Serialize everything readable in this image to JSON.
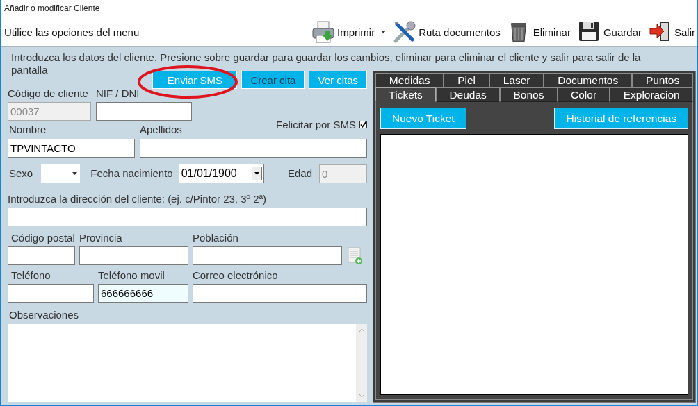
{
  "window": {
    "title": "Añadir o modificar Cliente"
  },
  "toolbar": {
    "hint": "Utilice las opciones del menu",
    "buttons": [
      {
        "label": "Imprimir",
        "kind": "print",
        "dropdown": true
      },
      {
        "label": "Ruta documentos",
        "kind": "tools",
        "dropdown": false
      },
      {
        "label": "Eliminar",
        "kind": "delete",
        "dropdown": false
      },
      {
        "label": "Guardar",
        "kind": "save",
        "dropdown": false
      },
      {
        "label": "Salir",
        "kind": "exit",
        "dropdown": false
      }
    ]
  },
  "form": {
    "instructions": "Introduzca los datos del cliente, Presione sobre guardar para guardar los cambios, eliminar para eliminar el cliente y salir para salir de la pantalla",
    "actions": [
      {
        "label": "Enviar SMS",
        "highlighted": true,
        "hovered": false
      },
      {
        "label": "Crear cita",
        "highlighted": false,
        "hovered": true
      },
      {
        "label": "Ver citas",
        "highlighted": false,
        "hovered": false
      }
    ],
    "customer_code": {
      "label": "Código de cliente",
      "value": "00037",
      "disabled": true
    },
    "nif": {
      "label": "NIF / DNI",
      "disabled": false
    },
    "birthday_sms": {
      "label": "Felicitar por SMS",
      "checked": true
    },
    "first_name": {
      "label": "Nombre",
      "value": "TPVINTACTO"
    },
    "last_name": {
      "label": "Apellidos"
    },
    "sex": {
      "label": "Sexo"
    },
    "birth_date": {
      "label": "Fecha nacimiento",
      "value": "01/01/1900"
    },
    "age": {
      "label": "Edad",
      "value": "0",
      "disabled": true
    },
    "address": {
      "label": "Introduzca la dirección del cliente: (ej. c/Pintor 23, 3º 2ª)"
    },
    "postal_code": {
      "label": "Código postal"
    },
    "province": {
      "label": "Provincia"
    },
    "town": {
      "label": "Población"
    },
    "phone": {
      "label": "Teléfono"
    },
    "mobile": {
      "label": "Teléfono movil",
      "value": "666666666",
      "focused": true
    },
    "email": {
      "label": "Correo electrónico"
    },
    "notes": {
      "label": "Observaciones"
    }
  },
  "detail_panel": {
    "tab_rows": [
      [
        {
          "label": "Medidas",
          "selected": false
        },
        {
          "label": "Piel",
          "selected": false
        },
        {
          "label": "Laser",
          "selected": false
        },
        {
          "label": "Documentos",
          "selected": false
        },
        {
          "label": "Puntos",
          "selected": false
        }
      ],
      [
        {
          "label": "Tickets",
          "selected": true
        },
        {
          "label": "Deudas",
          "selected": false
        },
        {
          "label": "Bonos",
          "selected": false
        },
        {
          "label": "Color",
          "selected": false
        },
        {
          "label": "Exploracion",
          "selected": false
        }
      ]
    ],
    "buttons": [
      "Nuevo Ticket",
      "Historial de referencias"
    ]
  }
}
